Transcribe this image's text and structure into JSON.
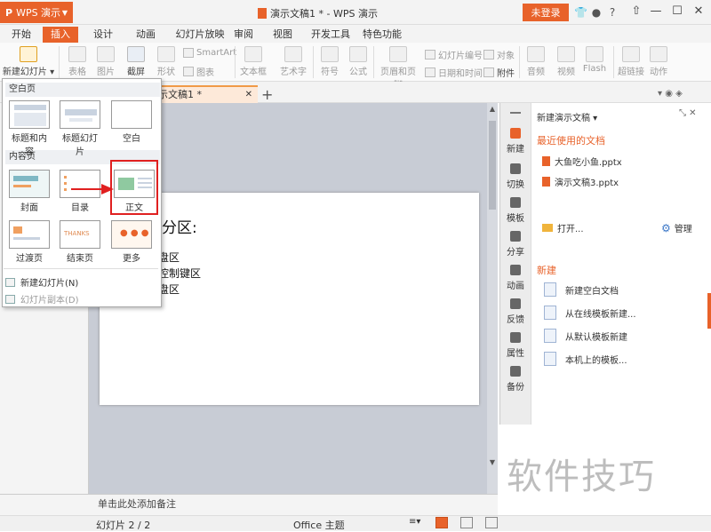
{
  "titlebar": {
    "app_name": "WPS 演示",
    "doc_title": "演示文稿1 * - WPS 演示",
    "login": "未登录"
  },
  "menu": {
    "tabs": [
      "开始",
      "插入",
      "设计",
      "动画",
      "幻灯片放映",
      "审阅",
      "视图",
      "开发工具",
      "特色功能"
    ],
    "active": "插入"
  },
  "ribbon": {
    "new_slide": "新建幻灯片",
    "table": "表格",
    "picture": "图片",
    "screenshot": "截屏",
    "shape": "形状",
    "smartart": "SmartArt",
    "chart": "图表",
    "textbox": "文本框",
    "wordart": "艺术字",
    "symbol": "符号",
    "formula": "公式",
    "header_footer": "页眉和页脚",
    "slide_number": "幻灯片编号",
    "object": "对象",
    "datetime": "日期和时间",
    "attachment": "附件",
    "audio": "音频",
    "video": "视频",
    "flash": "Flash",
    "hyperlink": "超链接",
    "action": "动作"
  },
  "doc_tab": {
    "label": "示文稿1 *"
  },
  "dropdown": {
    "section_blank": "空白页",
    "blank_items": [
      "标题和内容",
      "标题幻灯片",
      "空白"
    ],
    "section_content": "内容页",
    "content_items": [
      "封面",
      "目录",
      "正文"
    ],
    "more_items": [
      "过渡页",
      "结束页",
      "更多"
    ],
    "menu_new": "新建幻灯片(N)",
    "menu_copy": "幻灯片副本(D)",
    "thanks_text": "THANKS"
  },
  "slide": {
    "heading": "的分区:",
    "lines": [
      "盘区",
      "控制键区",
      "盘区"
    ]
  },
  "notes": "单击此处添加备注",
  "status": {
    "slide_count": "幻灯片 2 / 2",
    "theme": "Office 主题"
  },
  "side_tabs": [
    "新建",
    "切换",
    "模板",
    "分享",
    "动画",
    "反馈",
    "属性",
    "备份"
  ],
  "side_panel": {
    "title": "新建演示文稿",
    "recent_head": "最近使用的文档",
    "recent_files": [
      "大鱼吃小鱼.pptx",
      "演示文稿3.pptx"
    ],
    "open": "打开...",
    "manage": "管理",
    "new_head": "新建",
    "new_items": [
      "新建空白文档",
      "从在线模板新建...",
      "从默认模板新建",
      "本机上的模板..."
    ]
  },
  "watermark": "软件技巧",
  "colors": {
    "accent": "#e8622a",
    "highlight": "#e02020"
  }
}
